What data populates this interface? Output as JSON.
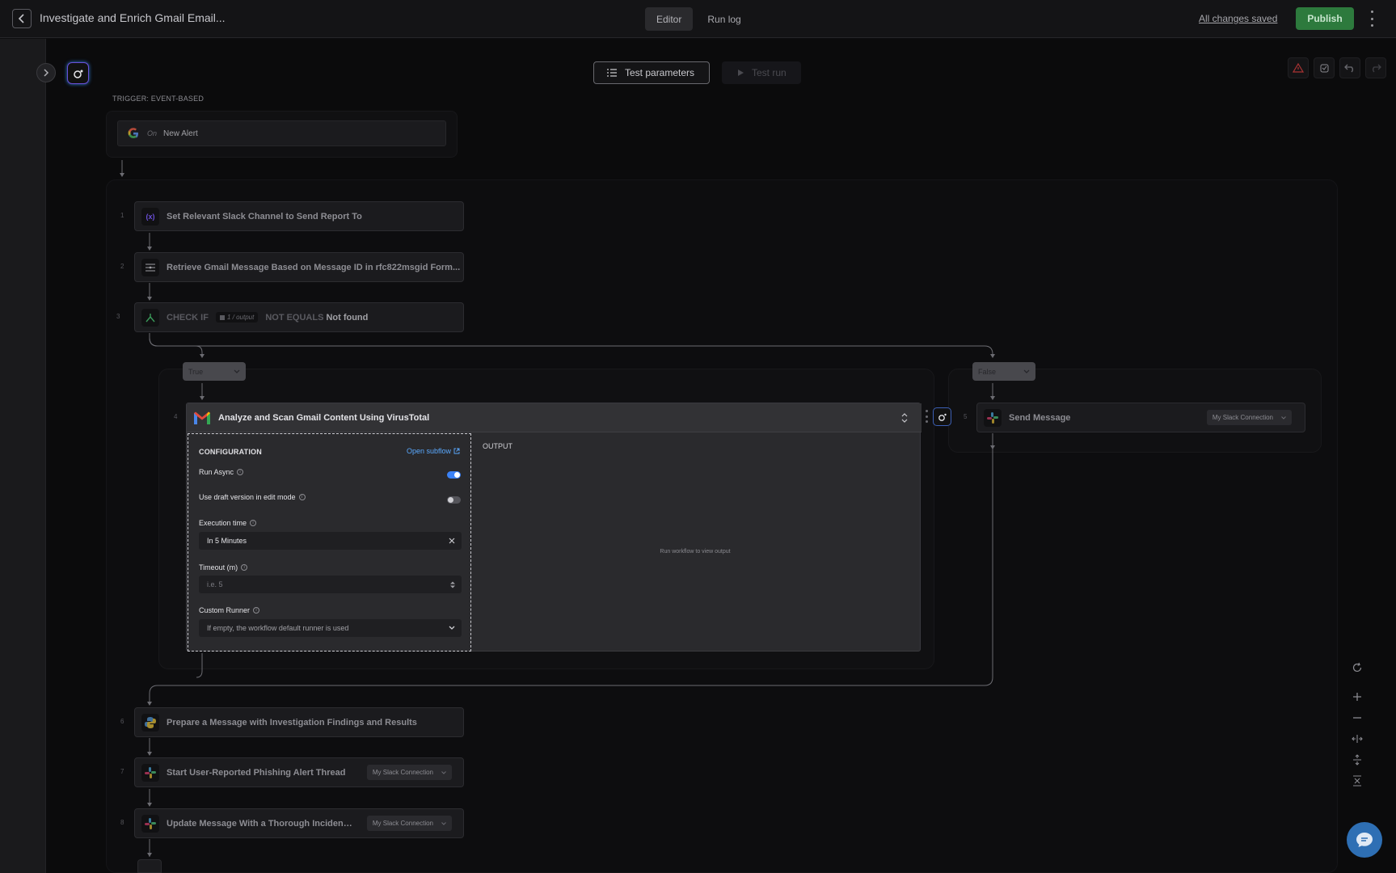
{
  "header": {
    "title": "Investigate and Enrich Gmail Email...",
    "tabs": [
      "Editor",
      "Run log"
    ],
    "active_tab": "Editor",
    "saved_status": "All changes saved",
    "publish_label": "Publish"
  },
  "toolbar": {
    "test_params_label": "Test parameters",
    "test_run_label": "Test run"
  },
  "trigger": {
    "section_label": "TRIGGER: EVENT-BASED",
    "on_label": "On",
    "event": "New Alert"
  },
  "steps": [
    {
      "num": "1",
      "label": "Set Relevant Slack Channel to Send Report To",
      "icon": "variable-icon"
    },
    {
      "num": "2",
      "label": "Retrieve Gmail Message Based on Message ID in rfc822msgid Form...",
      "icon": "transform-icon"
    },
    {
      "num": "3",
      "icon": "branch-icon",
      "check_if": "CHECK IF",
      "chip": "1 / output",
      "operator": "NOT EQUALS",
      "value": "Not found"
    },
    {
      "num": "6",
      "label": "Prepare a Message with Investigation Findings and Results",
      "icon": "python-icon"
    },
    {
      "num": "7",
      "label": "Start User-Reported Phishing Alert Thread",
      "icon": "slack-icon",
      "connection": "My Slack Connection"
    },
    {
      "num": "8",
      "label": "Update Message With a Thorough Incident ...",
      "icon": "slack-icon",
      "connection": "My Slack Connection"
    }
  ],
  "branches": {
    "true_label": "True",
    "false_label": "False"
  },
  "subflow_node": {
    "num": "4",
    "title": "Analyze and Scan Gmail Content Using VirusTotal",
    "config_title": "CONFIGURATION",
    "open_subflow": "Open subflow",
    "run_async_label": "Run Async",
    "run_async": true,
    "draft_label": "Use draft version in edit mode",
    "draft": false,
    "exec_time_label": "Execution time",
    "exec_time_value": "In 5 Minutes",
    "timeout_label": "Timeout (m)",
    "timeout_placeholder": "i.e. 5",
    "runner_label": "Custom Runner",
    "runner_placeholder": "If empty, the workflow default runner is used",
    "output_title": "OUTPUT",
    "output_hint": "Run workflow to view output"
  },
  "false_node": {
    "num": "5",
    "label": "Send Message",
    "connection": "My Slack Connection"
  },
  "colors": {
    "publish": "#2d7a3d",
    "link": "#5aa9ff",
    "toggle_on": "#3b82f6",
    "chat_fab": "#2e6fb4"
  }
}
